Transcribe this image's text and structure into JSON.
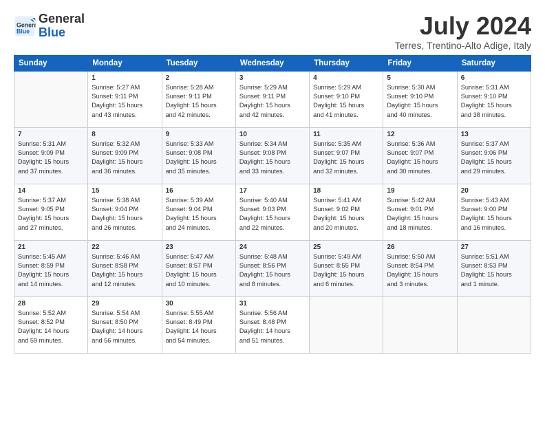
{
  "logo": {
    "line1": "General",
    "line2": "Blue"
  },
  "title": "July 2024",
  "subtitle": "Terres, Trentino-Alto Adige, Italy",
  "days_header": [
    "Sunday",
    "Monday",
    "Tuesday",
    "Wednesday",
    "Thursday",
    "Friday",
    "Saturday"
  ],
  "weeks": [
    [
      {
        "day": "",
        "info": ""
      },
      {
        "day": "1",
        "info": "Sunrise: 5:27 AM\nSunset: 9:11 PM\nDaylight: 15 hours\nand 43 minutes."
      },
      {
        "day": "2",
        "info": "Sunrise: 5:28 AM\nSunset: 9:11 PM\nDaylight: 15 hours\nand 42 minutes."
      },
      {
        "day": "3",
        "info": "Sunrise: 5:29 AM\nSunset: 9:11 PM\nDaylight: 15 hours\nand 42 minutes."
      },
      {
        "day": "4",
        "info": "Sunrise: 5:29 AM\nSunset: 9:10 PM\nDaylight: 15 hours\nand 41 minutes."
      },
      {
        "day": "5",
        "info": "Sunrise: 5:30 AM\nSunset: 9:10 PM\nDaylight: 15 hours\nand 40 minutes."
      },
      {
        "day": "6",
        "info": "Sunrise: 5:31 AM\nSunset: 9:10 PM\nDaylight: 15 hours\nand 38 minutes."
      }
    ],
    [
      {
        "day": "7",
        "info": "Sunrise: 5:31 AM\nSunset: 9:09 PM\nDaylight: 15 hours\nand 37 minutes."
      },
      {
        "day": "8",
        "info": "Sunrise: 5:32 AM\nSunset: 9:09 PM\nDaylight: 15 hours\nand 36 minutes."
      },
      {
        "day": "9",
        "info": "Sunrise: 5:33 AM\nSunset: 9:08 PM\nDaylight: 15 hours\nand 35 minutes."
      },
      {
        "day": "10",
        "info": "Sunrise: 5:34 AM\nSunset: 9:08 PM\nDaylight: 15 hours\nand 33 minutes."
      },
      {
        "day": "11",
        "info": "Sunrise: 5:35 AM\nSunset: 9:07 PM\nDaylight: 15 hours\nand 32 minutes."
      },
      {
        "day": "12",
        "info": "Sunrise: 5:36 AM\nSunset: 9:07 PM\nDaylight: 15 hours\nand 30 minutes."
      },
      {
        "day": "13",
        "info": "Sunrise: 5:37 AM\nSunset: 9:06 PM\nDaylight: 15 hours\nand 29 minutes."
      }
    ],
    [
      {
        "day": "14",
        "info": "Sunrise: 5:37 AM\nSunset: 9:05 PM\nDaylight: 15 hours\nand 27 minutes."
      },
      {
        "day": "15",
        "info": "Sunrise: 5:38 AM\nSunset: 9:04 PM\nDaylight: 15 hours\nand 26 minutes."
      },
      {
        "day": "16",
        "info": "Sunrise: 5:39 AM\nSunset: 9:04 PM\nDaylight: 15 hours\nand 24 minutes."
      },
      {
        "day": "17",
        "info": "Sunrise: 5:40 AM\nSunset: 9:03 PM\nDaylight: 15 hours\nand 22 minutes."
      },
      {
        "day": "18",
        "info": "Sunrise: 5:41 AM\nSunset: 9:02 PM\nDaylight: 15 hours\nand 20 minutes."
      },
      {
        "day": "19",
        "info": "Sunrise: 5:42 AM\nSunset: 9:01 PM\nDaylight: 15 hours\nand 18 minutes."
      },
      {
        "day": "20",
        "info": "Sunrise: 5:43 AM\nSunset: 9:00 PM\nDaylight: 15 hours\nand 16 minutes."
      }
    ],
    [
      {
        "day": "21",
        "info": "Sunrise: 5:45 AM\nSunset: 8:59 PM\nDaylight: 15 hours\nand 14 minutes."
      },
      {
        "day": "22",
        "info": "Sunrise: 5:46 AM\nSunset: 8:58 PM\nDaylight: 15 hours\nand 12 minutes."
      },
      {
        "day": "23",
        "info": "Sunrise: 5:47 AM\nSunset: 8:57 PM\nDaylight: 15 hours\nand 10 minutes."
      },
      {
        "day": "24",
        "info": "Sunrise: 5:48 AM\nSunset: 8:56 PM\nDaylight: 15 hours\nand 8 minutes."
      },
      {
        "day": "25",
        "info": "Sunrise: 5:49 AM\nSunset: 8:55 PM\nDaylight: 15 hours\nand 6 minutes."
      },
      {
        "day": "26",
        "info": "Sunrise: 5:50 AM\nSunset: 8:54 PM\nDaylight: 15 hours\nand 3 minutes."
      },
      {
        "day": "27",
        "info": "Sunrise: 5:51 AM\nSunset: 8:53 PM\nDaylight: 15 hours\nand 1 minute."
      }
    ],
    [
      {
        "day": "28",
        "info": "Sunrise: 5:52 AM\nSunset: 8:52 PM\nDaylight: 14 hours\nand 59 minutes."
      },
      {
        "day": "29",
        "info": "Sunrise: 5:54 AM\nSunset: 8:50 PM\nDaylight: 14 hours\nand 56 minutes."
      },
      {
        "day": "30",
        "info": "Sunrise: 5:55 AM\nSunset: 8:49 PM\nDaylight: 14 hours\nand 54 minutes."
      },
      {
        "day": "31",
        "info": "Sunrise: 5:56 AM\nSunset: 8:48 PM\nDaylight: 14 hours\nand 51 minutes."
      },
      {
        "day": "",
        "info": ""
      },
      {
        "day": "",
        "info": ""
      },
      {
        "day": "",
        "info": ""
      }
    ]
  ]
}
